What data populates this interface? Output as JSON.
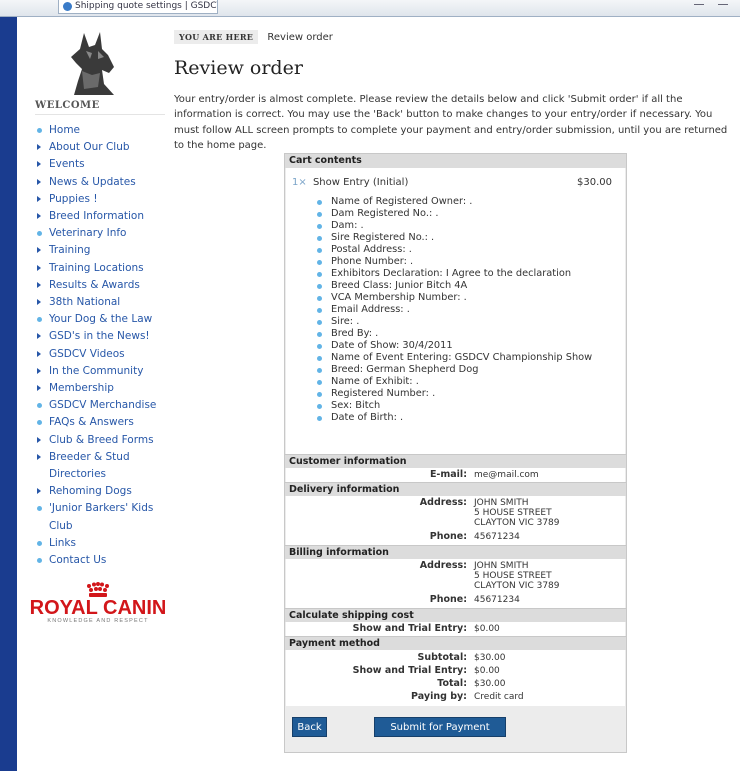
{
  "browser": {
    "tab_title": "Shipping quote settings | GSDCV"
  },
  "sidebar": {
    "welcome": "WELCOME",
    "items": [
      {
        "label": "Home",
        "bullet": "dot"
      },
      {
        "label": "About Our Club",
        "bullet": "arrow"
      },
      {
        "label": "Events",
        "bullet": "arrow"
      },
      {
        "label": "News & Updates",
        "bullet": "arrow"
      },
      {
        "label": "Puppies !",
        "bullet": "arrow"
      },
      {
        "label": "Breed Information",
        "bullet": "arrow"
      },
      {
        "label": "Veterinary Info",
        "bullet": "dot"
      },
      {
        "label": "Training",
        "bullet": "arrow"
      },
      {
        "label": "Training Locations",
        "bullet": "arrow"
      },
      {
        "label": "Results & Awards",
        "bullet": "arrow"
      },
      {
        "label": "38th National",
        "bullet": "arrow"
      },
      {
        "label": "Your Dog & the Law",
        "bullet": "dot"
      },
      {
        "label": "GSD's in the News!",
        "bullet": "arrow"
      },
      {
        "label": "GSDCV Videos",
        "bullet": "arrow"
      },
      {
        "label": "In the Community",
        "bullet": "arrow"
      },
      {
        "label": "Membership",
        "bullet": "arrow"
      },
      {
        "label": "GSDCV Merchandise",
        "bullet": "dot"
      },
      {
        "label": "FAQs & Answers",
        "bullet": "dot"
      },
      {
        "label": "Club & Breed Forms",
        "bullet": "arrow"
      },
      {
        "label": "Breeder & Stud Directories",
        "bullet": "arrow"
      },
      {
        "label": "Rehoming Dogs",
        "bullet": "arrow"
      },
      {
        "label": "'Junior Barkers' Kids Club",
        "bullet": "dot"
      },
      {
        "label": "Links",
        "bullet": "dot"
      },
      {
        "label": "Contact Us",
        "bullet": "dot"
      }
    ],
    "logo": {
      "brand": "ROYAL CANIN",
      "tagline": "KNOWLEDGE AND RESPECT"
    }
  },
  "breadcrumb": {
    "label": "YOU ARE HERE",
    "current": "Review order"
  },
  "page_title": "Review order",
  "intro": "Your entry/order is almost complete. Please review the details below and click 'Submit order' if all the information is correct. You may use the 'Back' button to make changes to your entry/order if necessary. You must follow ALL screen prompts to complete your payment and entry/order submission, until you are returned to the home page.",
  "cart": {
    "header": "Cart contents",
    "qty": "1×",
    "item": "Show Entry (Initial)",
    "price": "$30.00",
    "attributes": [
      "Name of Registered Owner: .",
      "Dam Registered No.: .",
      "Dam: .",
      "Sire Registered No.: .",
      "Postal Address: .",
      "Phone Number: .",
      "Exhibitors Declaration: I Agree to the declaration",
      "Breed Class: Junior Bitch 4A",
      "VCA Membership Number: .",
      "Email Address: .",
      "Sire: .",
      "Bred By: .",
      "Date of Show: 30/4/2011",
      "Name of Event Entering: GSDCV Championship Show",
      "Breed: German Shepherd Dog",
      "Name of Exhibit: .",
      "Registered Number: .",
      "Sex: Bitch",
      "Date of Birth: ."
    ]
  },
  "customer": {
    "header": "Customer information",
    "email_label": "E-mail:",
    "email": "me@mail.com"
  },
  "delivery": {
    "header": "Delivery information",
    "address_label": "Address:",
    "address_lines": [
      "JOHN SMITH",
      "5 HOUSE STREET",
      "CLAYTON VIC 3789"
    ],
    "phone_label": "Phone:",
    "phone": "45671234"
  },
  "billing": {
    "header": "Billing information",
    "address_label": "Address:",
    "address_lines": [
      "JOHN SMITH",
      "5 HOUSE STREET",
      "CLAYTON VIC 3789"
    ],
    "phone_label": "Phone:",
    "phone": "45671234"
  },
  "shipping": {
    "header": "Calculate shipping cost",
    "label": "Show and Trial Entry:",
    "value": "$0.00"
  },
  "payment": {
    "header": "Payment method",
    "subtotal_label": "Subtotal:",
    "subtotal": "$30.00",
    "entry_label": "Show and Trial Entry:",
    "entry": "$0.00",
    "total_label": "Total:",
    "total": "$30.00",
    "paying_label": "Paying by:",
    "paying": "Credit card"
  },
  "buttons": {
    "back": "Back",
    "submit": "Submit for Payment"
  },
  "colors": {
    "link": "#2757a8",
    "bullet": "#62b4e6",
    "button": "#1f5b96",
    "stripe": "#1a3c8f",
    "logo_red": "#d2161a"
  }
}
